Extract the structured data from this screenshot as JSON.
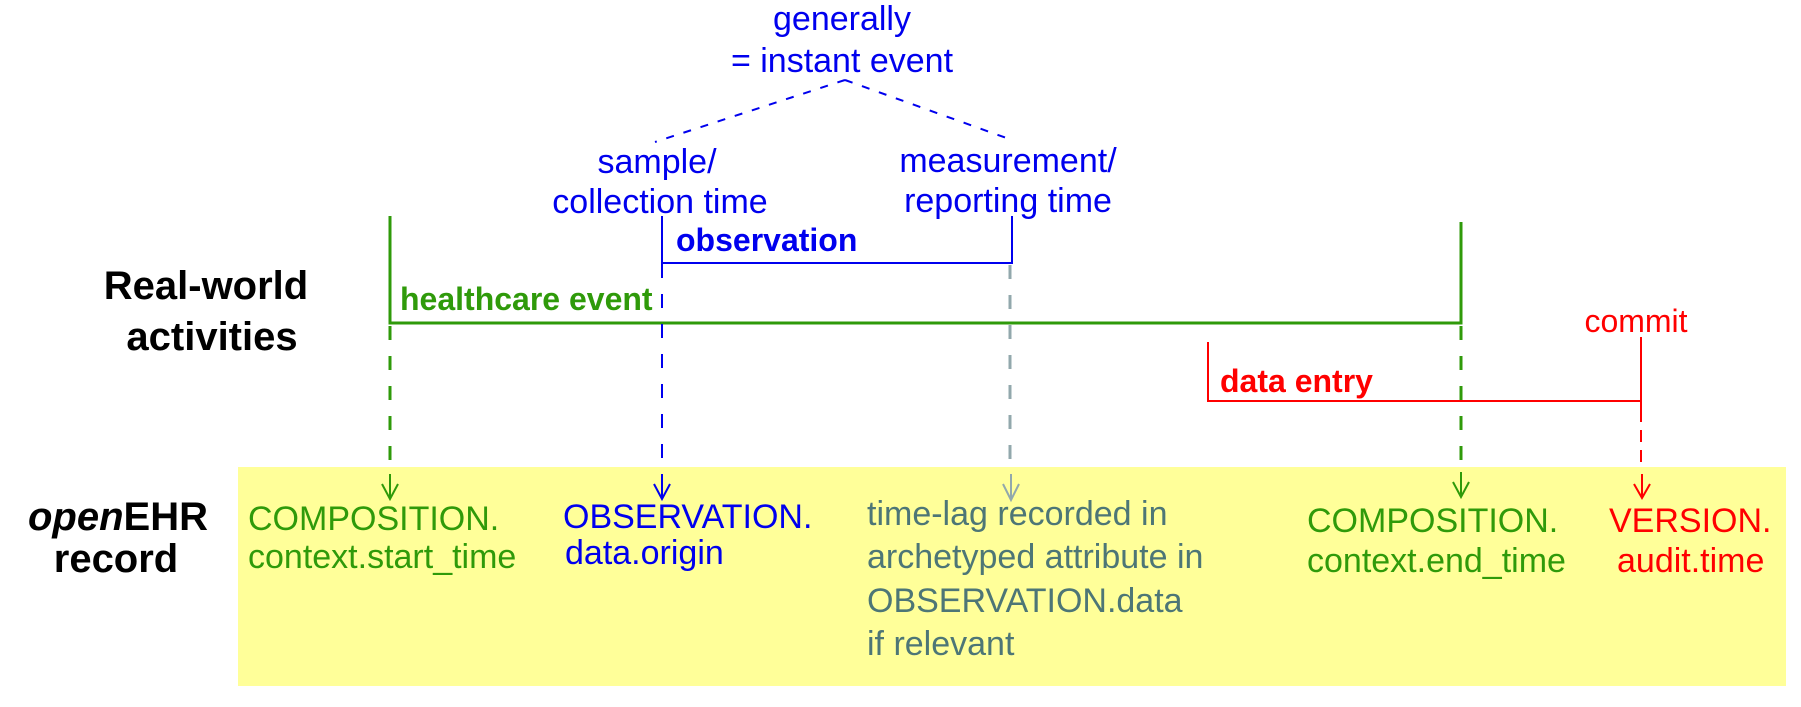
{
  "colors": {
    "blue": "#0000ee",
    "green": "#2f9a0a",
    "red": "#ff0000",
    "gray_text": "#4d7676",
    "gray_line": "#92a8ac",
    "record_bg": "#ffff99"
  },
  "row_labels": {
    "real_world_line1": "Real-world",
    "real_world_line2": "activities",
    "record_italic": "open",
    "record_bold": "EHR",
    "record_line2": "record"
  },
  "annotation": {
    "line1": "generally",
    "line2": "= instant event"
  },
  "time_points": {
    "sample_line1": "sample/",
    "sample_line2": "collection time",
    "measurement_line1": "measurement/",
    "measurement_line2": "reporting time",
    "commit": "commit"
  },
  "intervals": {
    "observation": "observation",
    "healthcare_event": "healthcare event",
    "data_entry": "data entry"
  },
  "record_fields": {
    "composition_start": {
      "line1": "COMPOSITION.",
      "line2": "context.start_time"
    },
    "observation_origin": {
      "line1": "OBSERVATION.",
      "line2": "data.origin"
    },
    "time_lag": {
      "line1": "time-lag recorded in",
      "line2": "archetyped attribute in",
      "line3": "OBSERVATION.data",
      "line4": "if relevant"
    },
    "composition_end": {
      "line1": "COMPOSITION.",
      "line2": "context.end_time"
    },
    "version_audit": {
      "line1": "VERSION.",
      "line2": "audit.time"
    }
  }
}
